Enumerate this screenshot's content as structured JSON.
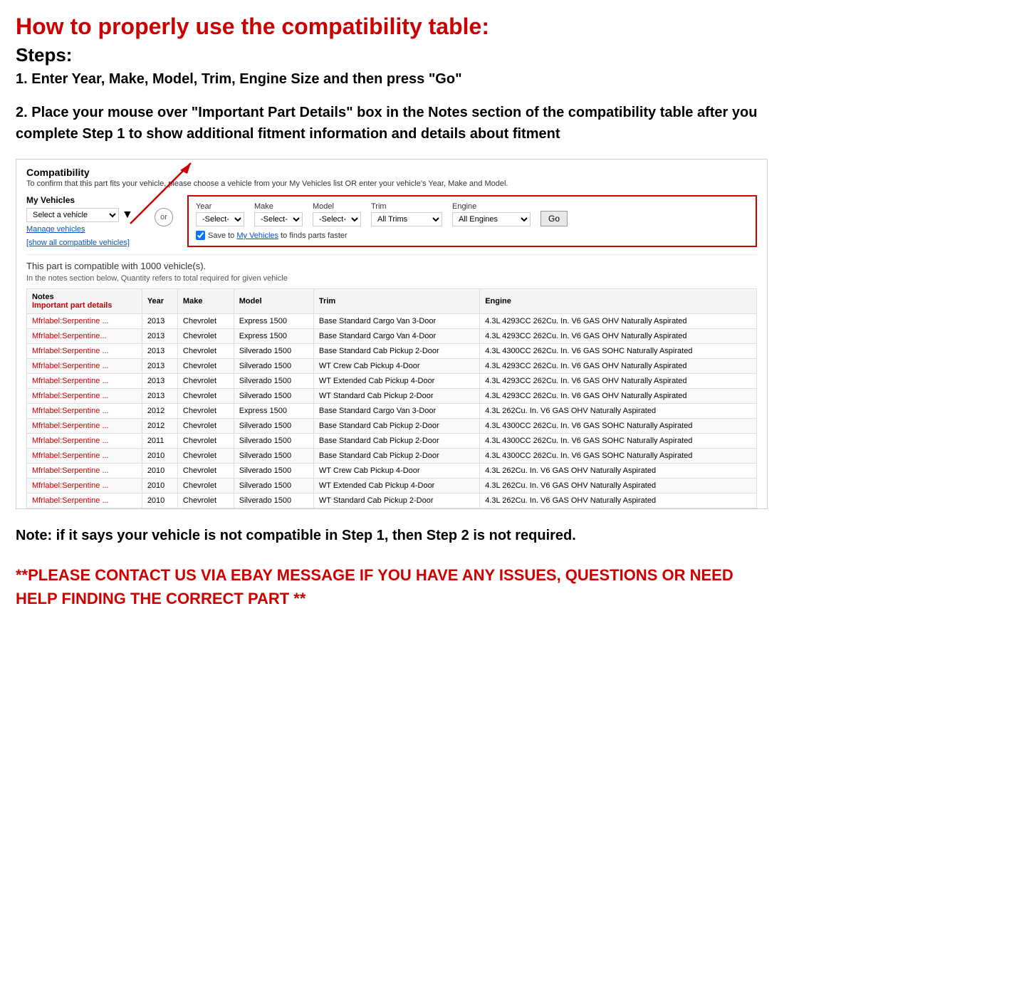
{
  "title": "How to properly use the compatibility table:",
  "steps_heading": "Steps:",
  "step1": "1. Enter Year, Make, Model, Trim, Engine Size and then press \"Go\"",
  "step2": "2. Place your mouse over \"Important Part Details\" box in the Notes section of the compatibility table after you complete Step 1 to show additional fitment information and details about fitment",
  "compat": {
    "section_title": "Compatibility",
    "subtitle": "To confirm that this part fits your vehicle, please choose a vehicle from your My Vehicles list OR enter your vehicle's Year, Make and Model.",
    "my_vehicles_label": "My Vehicles",
    "select_vehicle_placeholder": "Select a vehicle",
    "manage_vehicles": "Manage vehicles",
    "show_all": "[show all compatible vehicles]",
    "or_label": "or",
    "year_label": "Year",
    "year_value": "-Select-",
    "make_label": "Make",
    "make_value": "-Select-",
    "model_label": "Model",
    "model_value": "-Select-",
    "trim_label": "Trim",
    "trim_value": "All Trims",
    "engine_label": "Engine",
    "engine_value": "All Engines",
    "go_label": "Go",
    "save_text": "Save to My Vehicles to finds parts faster",
    "compatible_count": "This part is compatible with 1000 vehicle(s).",
    "quantity_note": "In the notes section below, Quantity refers to total required for given vehicle",
    "table_headers": {
      "notes": "Notes",
      "important_part": "Important part details",
      "year": "Year",
      "make": "Make",
      "model": "Model",
      "trim": "Trim",
      "engine": "Engine"
    },
    "rows": [
      {
        "notes": "Mfrlabel:Serpentine ...",
        "year": "2013",
        "make": "Chevrolet",
        "model": "Express 1500",
        "trim": "Base Standard Cargo Van 3-Door",
        "engine": "4.3L 4293CC 262Cu. In. V6 GAS OHV Naturally Aspirated"
      },
      {
        "notes": "Mfrlabel:Serpentine...",
        "year": "2013",
        "make": "Chevrolet",
        "model": "Express 1500",
        "trim": "Base Standard Cargo Van 4-Door",
        "engine": "4.3L 4293CC 262Cu. In. V6 GAS OHV Naturally Aspirated"
      },
      {
        "notes": "Mfrlabel:Serpentine ...",
        "year": "2013",
        "make": "Chevrolet",
        "model": "Silverado 1500",
        "trim": "Base Standard Cab Pickup 2-Door",
        "engine": "4.3L 4300CC 262Cu. In. V6 GAS SOHC Naturally Aspirated"
      },
      {
        "notes": "Mfrlabel:Serpentine ...",
        "year": "2013",
        "make": "Chevrolet",
        "model": "Silverado 1500",
        "trim": "WT Crew Cab Pickup 4-Door",
        "engine": "4.3L 4293CC 262Cu. In. V6 GAS OHV Naturally Aspirated"
      },
      {
        "notes": "Mfrlabel:Serpentine ...",
        "year": "2013",
        "make": "Chevrolet",
        "model": "Silverado 1500",
        "trim": "WT Extended Cab Pickup 4-Door",
        "engine": "4.3L 4293CC 262Cu. In. V6 GAS OHV Naturally Aspirated"
      },
      {
        "notes": "Mfrlabel:Serpentine ...",
        "year": "2013",
        "make": "Chevrolet",
        "model": "Silverado 1500",
        "trim": "WT Standard Cab Pickup 2-Door",
        "engine": "4.3L 4293CC 262Cu. In. V6 GAS OHV Naturally Aspirated"
      },
      {
        "notes": "Mfrlabel:Serpentine ...",
        "year": "2012",
        "make": "Chevrolet",
        "model": "Express 1500",
        "trim": "Base Standard Cargo Van 3-Door",
        "engine": "4.3L 262Cu. In. V6 GAS OHV Naturally Aspirated"
      },
      {
        "notes": "Mfrlabel:Serpentine ...",
        "year": "2012",
        "make": "Chevrolet",
        "model": "Silverado 1500",
        "trim": "Base Standard Cab Pickup 2-Door",
        "engine": "4.3L 4300CC 262Cu. In. V6 GAS SOHC Naturally Aspirated"
      },
      {
        "notes": "Mfrlabel:Serpentine ...",
        "year": "2011",
        "make": "Chevrolet",
        "model": "Silverado 1500",
        "trim": "Base Standard Cab Pickup 2-Door",
        "engine": "4.3L 4300CC 262Cu. In. V6 GAS SOHC Naturally Aspirated"
      },
      {
        "notes": "Mfrlabel:Serpentine ...",
        "year": "2010",
        "make": "Chevrolet",
        "model": "Silverado 1500",
        "trim": "Base Standard Cab Pickup 2-Door",
        "engine": "4.3L 4300CC 262Cu. In. V6 GAS SOHC Naturally Aspirated"
      },
      {
        "notes": "Mfrlabel:Serpentine ...",
        "year": "2010",
        "make": "Chevrolet",
        "model": "Silverado 1500",
        "trim": "WT Crew Cab Pickup 4-Door",
        "engine": "4.3L 262Cu. In. V6 GAS OHV Naturally Aspirated"
      },
      {
        "notes": "Mfrlabel:Serpentine ...",
        "year": "2010",
        "make": "Chevrolet",
        "model": "Silverado 1500",
        "trim": "WT Extended Cab Pickup 4-Door",
        "engine": "4.3L 262Cu. In. V6 GAS OHV Naturally Aspirated"
      },
      {
        "notes": "Mfrlabel:Serpentine ...",
        "year": "2010",
        "make": "Chevrolet",
        "model": "Silverado 1500",
        "trim": "WT Standard Cab Pickup 2-Door",
        "engine": "4.3L 262Cu. In. V6 GAS OHV Naturally Aspirated"
      }
    ]
  },
  "note": "Note: if it says your vehicle is not compatible in Step 1, then Step 2 is not required.",
  "contact": "**PLEASE CONTACT US VIA EBAY MESSAGE IF YOU HAVE ANY ISSUES, QUESTIONS OR NEED HELP FINDING THE CORRECT PART **"
}
